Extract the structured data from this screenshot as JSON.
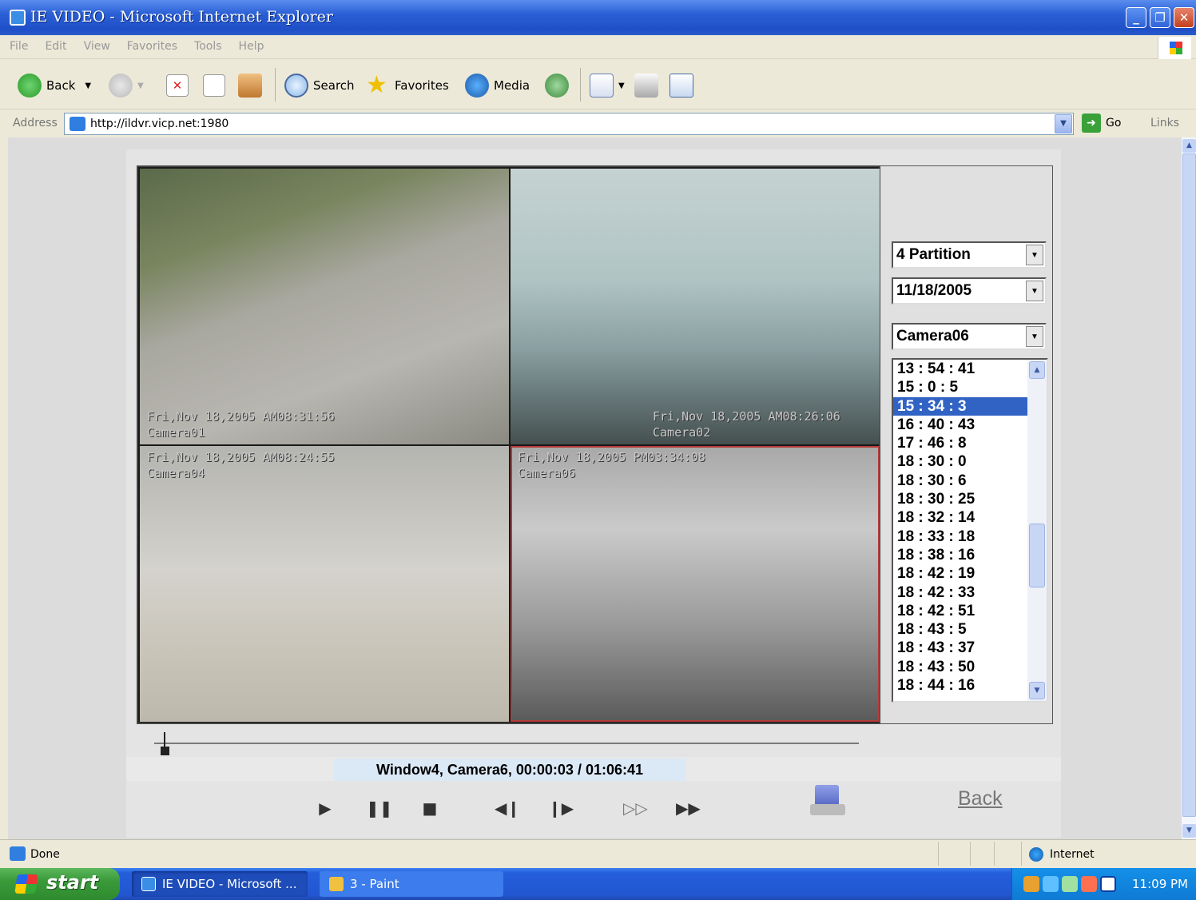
{
  "window": {
    "title": "IE VIDEO - Microsoft Internet Explorer"
  },
  "menu": [
    "File",
    "Edit",
    "View",
    "Favorites",
    "Tools",
    "Help"
  ],
  "toolbar": {
    "back": "Back",
    "search": "Search",
    "favorites": "Favorites",
    "media": "Media"
  },
  "address": {
    "label": "Address",
    "url": "http://ildvr.vicp.net:1980",
    "go": "Go",
    "links": "Links"
  },
  "cameras": [
    {
      "overlay_line1": "Fri,Nov 18,2005 AM08:31:56",
      "overlay_line2": "Camera01"
    },
    {
      "overlay_line1": "Fri,Nov 18,2005 AM08:26:06",
      "overlay_line2": "Camera02"
    },
    {
      "overlay_line1": "Fri,Nov 18,2005 AM08:24:55",
      "overlay_line2": "Camera04"
    },
    {
      "overlay_line1": "Fri,Nov 18,2005 PM03:34:08",
      "overlay_line2": "Camera06"
    }
  ],
  "panel": {
    "partition": "4 Partition",
    "date": "11/18/2005",
    "camera": "Camera06",
    "times": [
      "13 : 54 : 41",
      "15 : 0 : 5",
      "15 : 34 : 3",
      "16 : 40 : 43",
      "17 : 46 : 8",
      "18 : 30 : 0",
      "18 : 30 : 6",
      "18 : 30 : 25",
      "18 : 32 : 14",
      "18 : 33 : 18",
      "18 : 38 : 16",
      "18 : 42 : 19",
      "18 : 42 : 33",
      "18 : 42 : 51",
      "18 : 43 : 5",
      "18 : 43 : 37",
      "18 : 43 : 50",
      "18 : 44 : 16"
    ],
    "selected_index": 2
  },
  "playback": {
    "status": "Window4,  Camera6,  00:00:03 / 01:06:41",
    "position_fraction": 0.0,
    "back_label": "Back"
  },
  "statusbar": {
    "left": "Done",
    "zone": "Internet"
  },
  "taskbar": {
    "start": "start",
    "task1": "IE VIDEO - Microsoft ...",
    "task2": "3 - Paint",
    "clock": "11:09 PM"
  }
}
